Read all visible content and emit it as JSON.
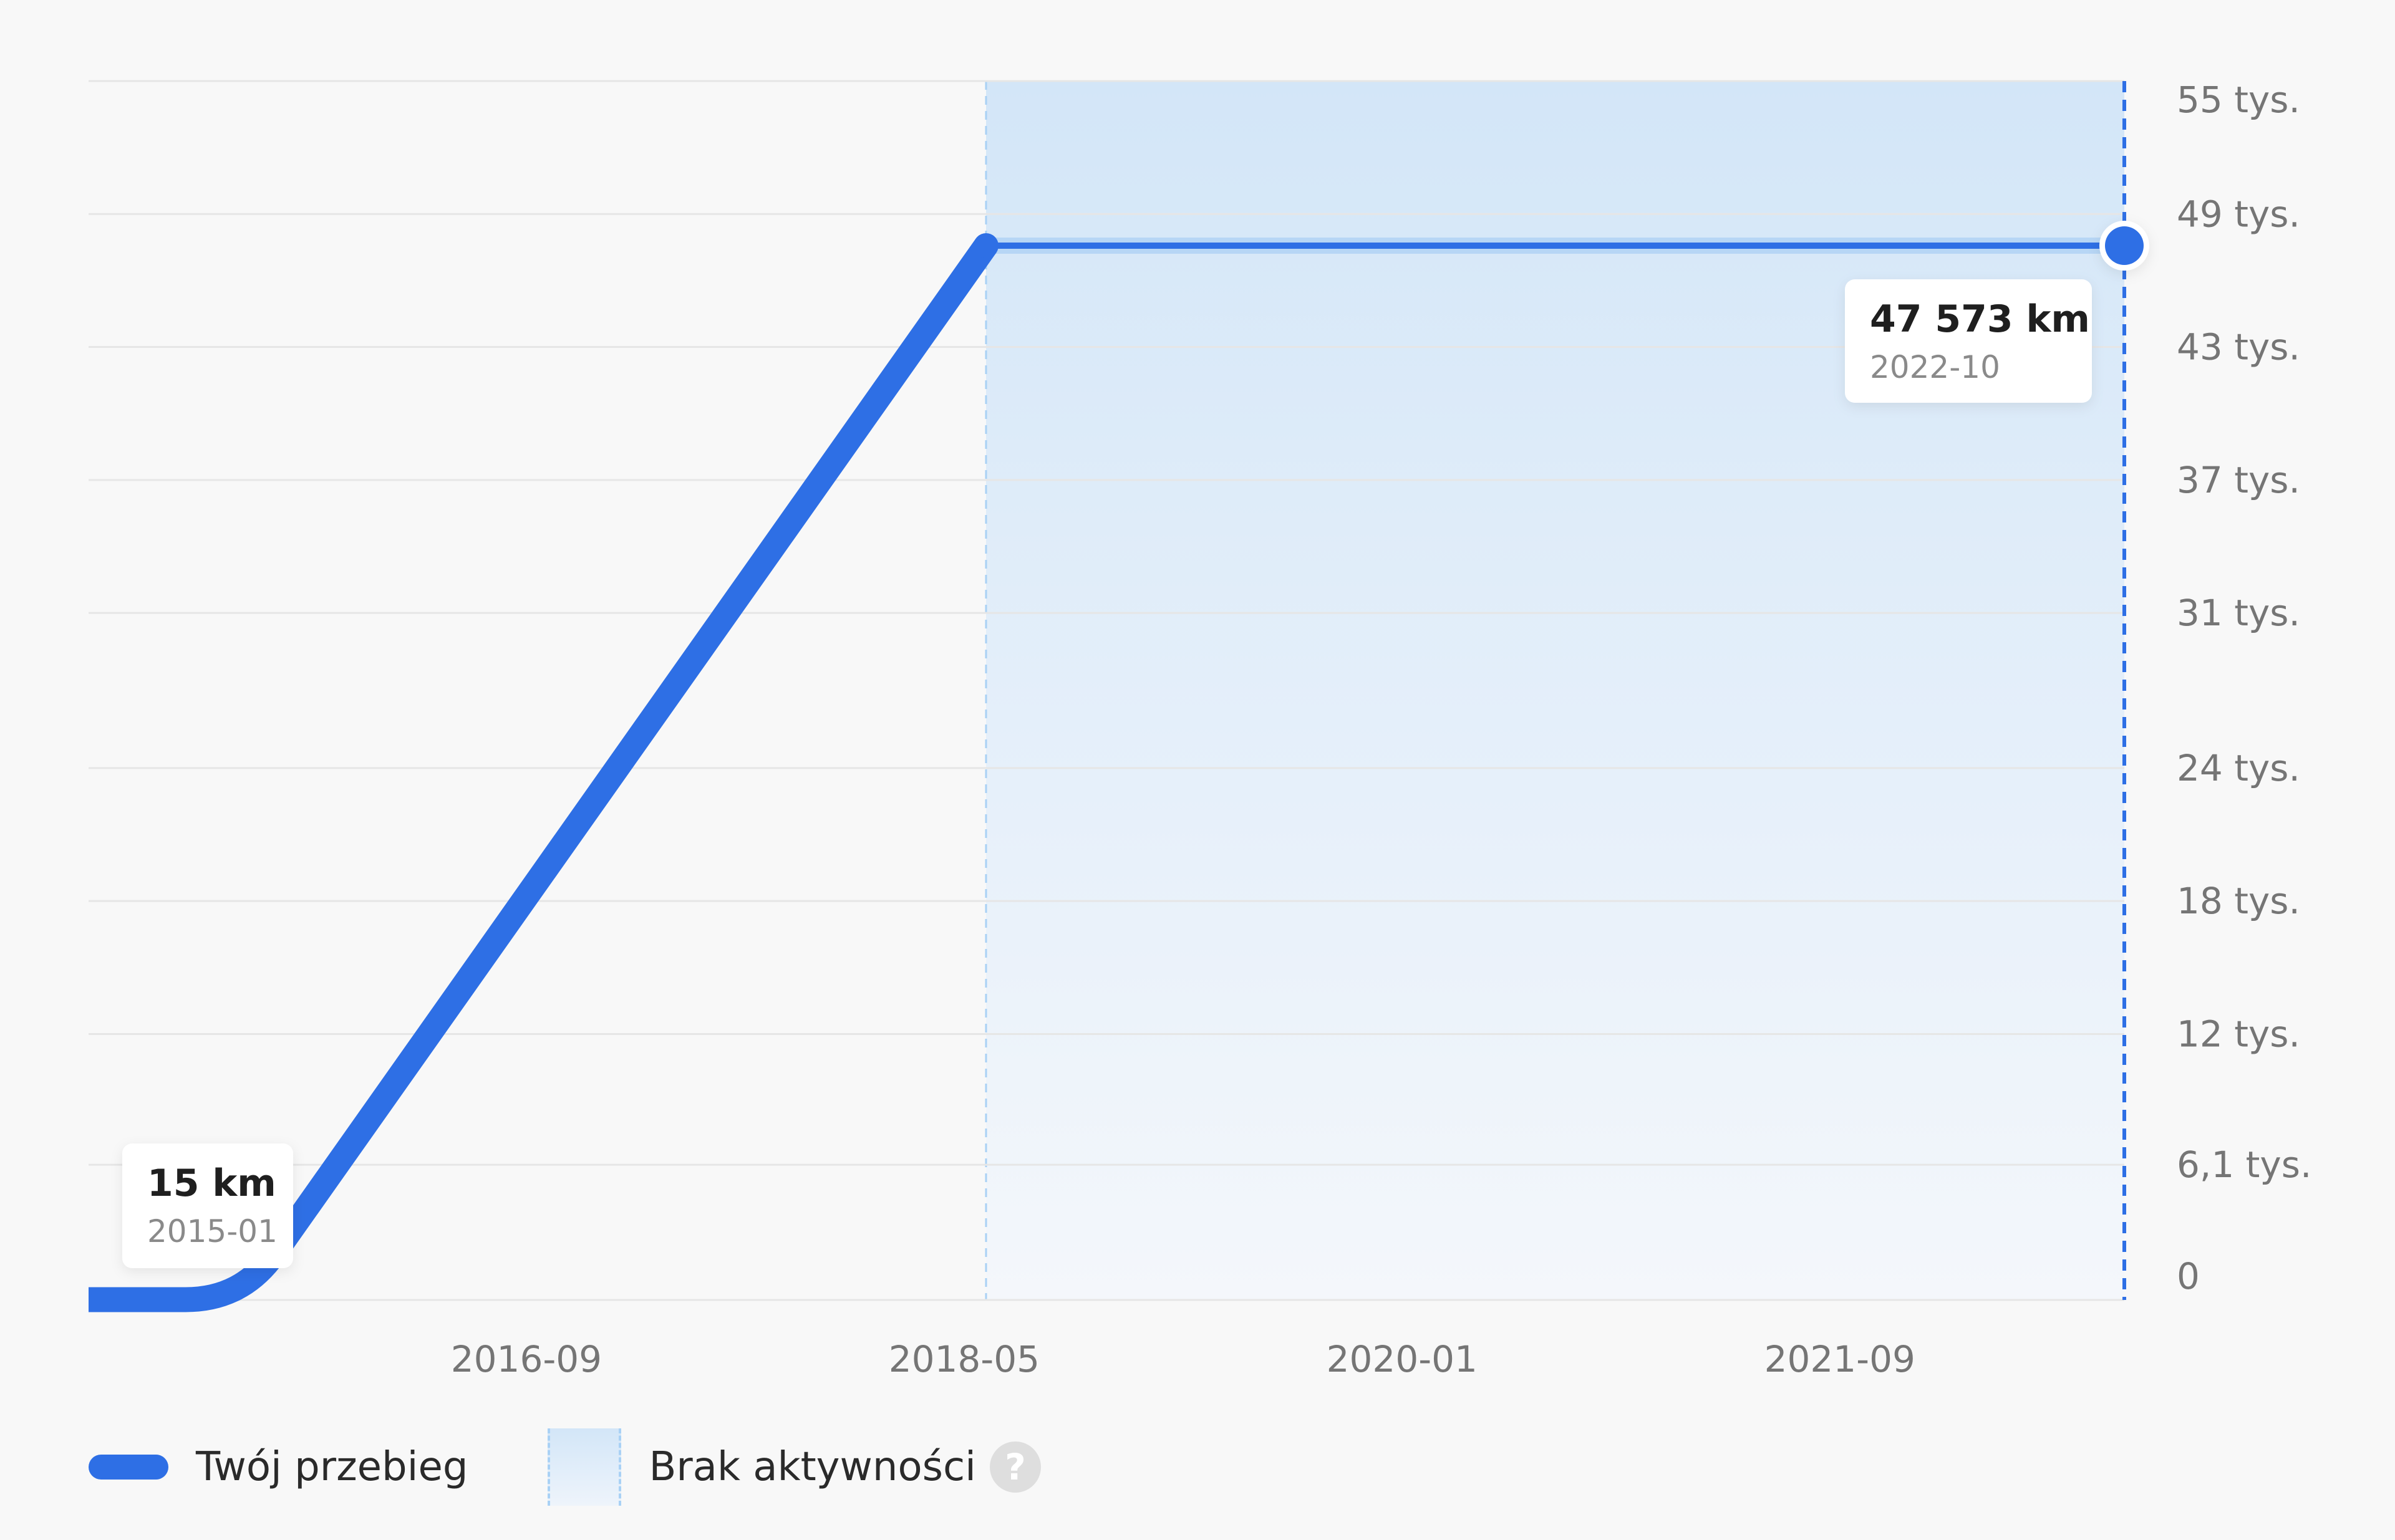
{
  "chart_data": {
    "type": "line",
    "series": [
      {
        "name": "Twój przebieg",
        "x": [
          "2015-01",
          "2015-08",
          "2018-06",
          "2022-10"
        ],
        "values": [
          15,
          15,
          47573,
          47573
        ]
      }
    ],
    "ylim": [
      0,
      55000
    ],
    "yticks": [
      {
        "value": 0,
        "label": "0"
      },
      {
        "value": 6100,
        "label": "6,1 tys."
      },
      {
        "value": 12000,
        "label": "12 tys."
      },
      {
        "value": 18000,
        "label": "18 tys."
      },
      {
        "value": 24000,
        "label": "24 tys."
      },
      {
        "value": 31000,
        "label": "31 tys."
      },
      {
        "value": 37000,
        "label": "37 tys."
      },
      {
        "value": 43000,
        "label": "43 tys."
      },
      {
        "value": 49000,
        "label": "49 tys."
      },
      {
        "value": 55000,
        "label": "55 tys."
      }
    ],
    "xlim": [
      "2015-01",
      "2022-10"
    ],
    "xticks": [
      "2016-09",
      "2018-05",
      "2020-01",
      "2021-09"
    ],
    "inactivity_range": [
      "2018-06",
      "2022-10"
    ],
    "tooltips": [
      {
        "value_label": "15 km",
        "date": "2015-01",
        "x": "2015-01",
        "y": 15
      },
      {
        "value_label": "47 573 km",
        "date": "2022-10",
        "x": "2022-10",
        "y": 47573
      }
    ],
    "grid": true,
    "legend_position": "bottom-left"
  },
  "legend": {
    "series_label": "Twój przebieg",
    "inactivity_label": "Brak aktywności",
    "help_glyph": "?"
  },
  "colors": {
    "line": "#2e6fe5",
    "inactivity_fill_top": "#d3e6f8",
    "inactivity_fill_bottom": "#eef4fb",
    "inactivity_border": "#a9d1f5",
    "grid": "#e6e6e6",
    "background": "#f8f8f8"
  }
}
